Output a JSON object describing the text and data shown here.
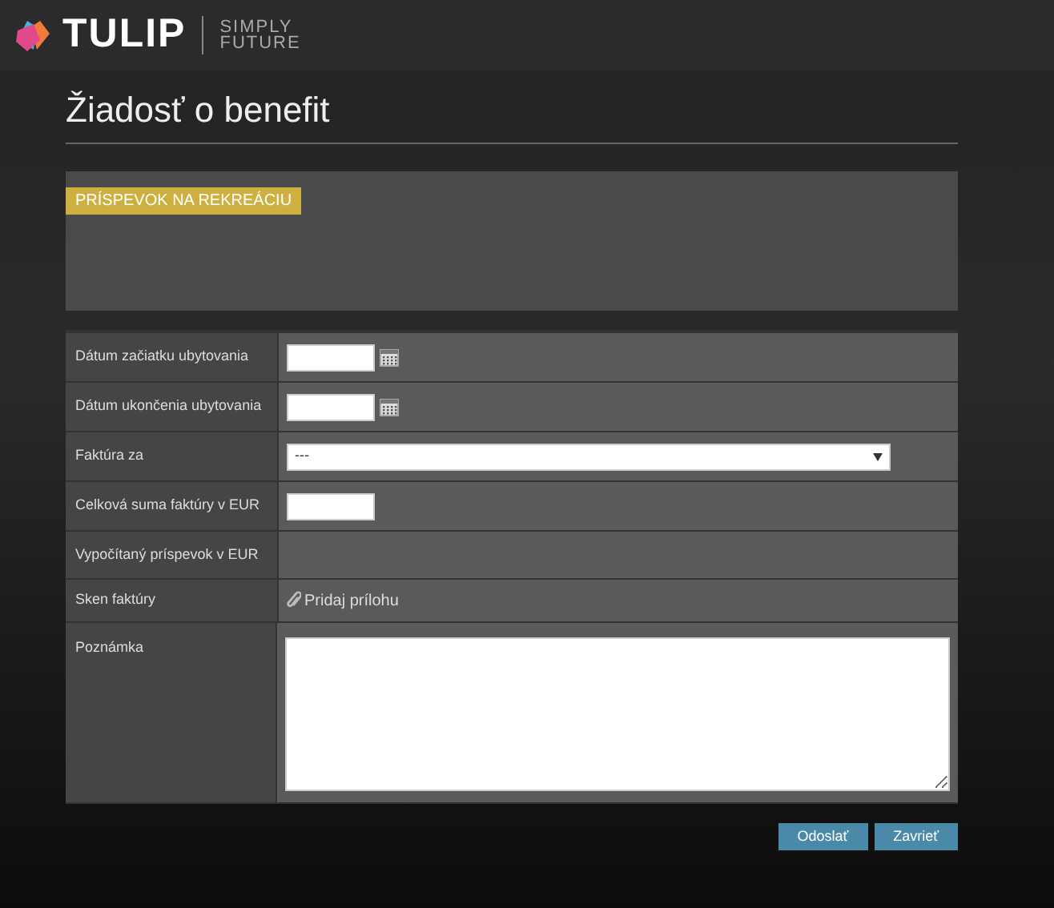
{
  "header": {
    "logo_text": "TULIP",
    "tagline_top": "SIMPLY",
    "tagline_bottom": "FUTURE"
  },
  "page_title": "Žiadosť o benefit",
  "benefit_panel": {
    "badge": "PRÍSPEVOK NA REKREÁCIU"
  },
  "form_rows": [
    {
      "label": "Dátum začiatku ubytovania",
      "kind": "date"
    },
    {
      "label": "Dátum ukončenia ubytovania",
      "kind": "date"
    },
    {
      "label": "Faktúra za",
      "kind": "select",
      "value": "---"
    },
    {
      "label": "Celková suma faktúry v EUR",
      "kind": "text"
    },
    {
      "label": "Vypočítaný príspevok v EUR",
      "kind": "empty"
    },
    {
      "label": "Sken faktúry",
      "kind": "attachment",
      "link": "Pridaj prílohu"
    },
    {
      "label": "Poznámka",
      "kind": "textarea"
    }
  ],
  "buttons": [
    "Odoslať",
    "Zavrieť"
  ]
}
